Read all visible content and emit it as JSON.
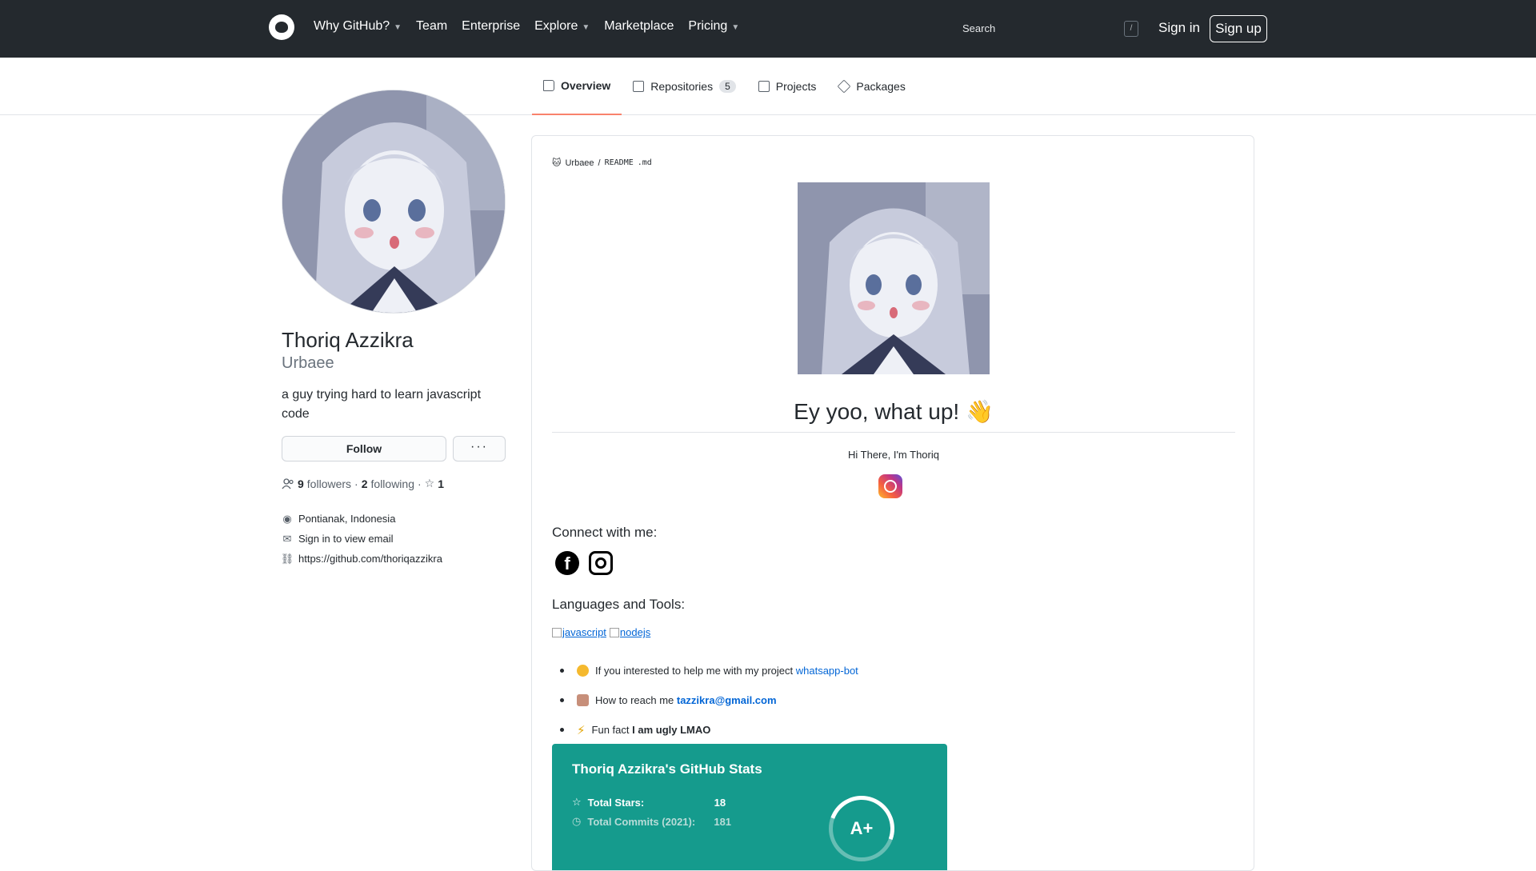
{
  "header": {
    "nav": [
      {
        "label": "Why GitHub?",
        "dropdown": true
      },
      {
        "label": "Team",
        "dropdown": false
      },
      {
        "label": "Enterprise",
        "dropdown": false
      },
      {
        "label": "Explore",
        "dropdown": true
      },
      {
        "label": "Marketplace",
        "dropdown": false
      },
      {
        "label": "Pricing",
        "dropdown": true
      }
    ],
    "search_placeholder": "Search",
    "search_shortcut": "/",
    "signin": "Sign in",
    "signup": "Sign up"
  },
  "tabs": [
    {
      "label": "Overview",
      "active": true,
      "icon": "book-icon"
    },
    {
      "label": "Repositories",
      "count": "5",
      "icon": "repo-icon"
    },
    {
      "label": "Projects",
      "icon": "project-icon"
    },
    {
      "label": "Packages",
      "icon": "package-icon"
    }
  ],
  "profile": {
    "name": "Thoriq Azzikra",
    "login": "Urbaee",
    "bio": "a guy trying hard to learn javascript code",
    "follow_label": "Follow",
    "more_label": "···",
    "followers_count": "9",
    "followers_label": "followers",
    "following_count": "2",
    "following_label": "following",
    "stars_count": "1",
    "location": "Pontianak, Indonesia",
    "email": "Sign in to view email",
    "website": "https://github.com/thoriqazzikra"
  },
  "readme": {
    "path_user": "Urbaee",
    "path_sep": "/",
    "path_file": "README",
    "path_ext": ".md",
    "headline": "Ey yoo, what up! 👋",
    "intro": "Hi There, I'm Thoriq",
    "connect_heading": "Connect with me:",
    "tools_heading": "Languages and Tools:",
    "tools": [
      "javascript",
      "nodejs"
    ],
    "bullets": [
      {
        "text": "If you interested to help me with my project ",
        "link": "whatsapp-bot",
        "emoji_color": "#f5b92e"
      },
      {
        "text": "How to reach me ",
        "link": "tazzikra@gmail.com",
        "emoji_color": "#c78f7a"
      },
      {
        "text": "Fun fact ",
        "bold": "I am ugly LMAO",
        "emoji_color": "#f1c40f"
      }
    ]
  },
  "stats_card": {
    "title": "Thoriq Azzikra's GitHub Stats",
    "rows": [
      {
        "label": "Total Stars:",
        "value": "18",
        "color": "#ffffff"
      },
      {
        "label": "Total Commits (2021):",
        "value": "181",
        "color": "#b8dcd8"
      }
    ],
    "grade": "A+",
    "bg_color": "#159b8d"
  }
}
